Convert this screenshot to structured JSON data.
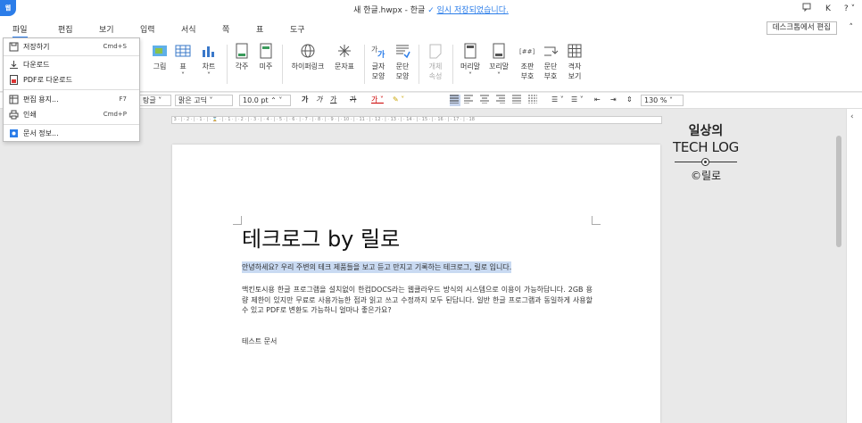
{
  "titlebar": {
    "app_logo": "웹",
    "filename": "새 한글.hwpx - 한글",
    "saved_status": "임시 저장되었습니다.",
    "comment_icon": "comment-icon",
    "user_initial": "K",
    "help": "?"
  },
  "menubar": {
    "items": [
      "파일",
      "편집",
      "보기",
      "입력",
      "서식",
      "쪽",
      "표",
      "도구"
    ],
    "desktop_edit": "데스크톱에서 편집"
  },
  "ribbon": {
    "items": [
      {
        "label": "그림"
      },
      {
        "label": "표"
      },
      {
        "label": "차트"
      },
      {
        "label": "각주"
      },
      {
        "label": "미주"
      },
      {
        "label": "하이퍼링크"
      },
      {
        "label": "문자표"
      },
      {
        "label": "글자 모양"
      },
      {
        "label": "문단 모양"
      },
      {
        "label": "개체 속성"
      },
      {
        "label": "머리말"
      },
      {
        "label": "꼬리말"
      },
      {
        "label": "조판 부호"
      },
      {
        "label": "문단 부호"
      },
      {
        "label": "격자 보기"
      }
    ]
  },
  "format_toolbar": {
    "style": "바탕글",
    "style_visible": "탕글",
    "font": "맑은 고딕",
    "size": "10.0",
    "size_unit": "pt",
    "bold": "가",
    "italic": "가",
    "underline": "가",
    "strike": "가",
    "line_spacing": "130",
    "line_spacing_unit": "%"
  },
  "file_menu": {
    "items": [
      {
        "label": "저장하기",
        "shortcut": "Cmd+S",
        "icon": "save-icon"
      },
      {
        "label": "다운로드",
        "shortcut": "",
        "icon": "download-icon"
      },
      {
        "label": "PDF로 다운로드",
        "shortcut": "",
        "icon": "pdf-icon"
      },
      {
        "label": "편집 용지...",
        "shortcut": "F7",
        "icon": "page-setup-icon"
      },
      {
        "label": "인쇄",
        "shortcut": "Cmd+P",
        "icon": "print-icon"
      },
      {
        "label": "문서 정보...",
        "shortcut": "",
        "icon": "info-icon"
      }
    ]
  },
  "document": {
    "title": "테크로그 by 릴로",
    "line1": "안녕하세요? 우리 주변의 테크 제품들을 보고 듣고 만지고 기록하는 테크로그, 릴로 입니다.",
    "paragraph": "맥킨토시용 한글 프로그램을 설치없이 한컴DOCS라는 웹클라우드 방식의 시스템으로 이용이 가능하답니다. 2GB 용량 제한이 있지만 무료로 사용가능한 점과 읽고 쓰고 수정까지 모두 된답니다. 일반 한글 프로그램과 동일하게 사용할 수 있고 PDF로 변환도 가능하니 얼마나 좋은가요?",
    "test_line": "테스트 문서"
  },
  "watermark": {
    "line1": "일상의",
    "line2": "TECH LOG",
    "line3": "©릴로"
  },
  "colors": {
    "accent": "#2b7de9",
    "selection": "#c9daf2",
    "background": "#e9e9e9"
  }
}
